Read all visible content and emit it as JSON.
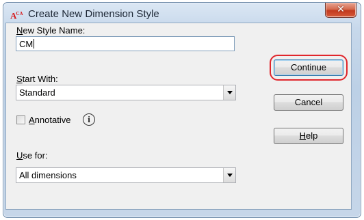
{
  "window": {
    "title": "Create New Dimension Style",
    "close_label": "✕"
  },
  "form": {
    "new_style_name_label": "New Style Name:",
    "new_style_name_value": "CM",
    "start_with_label": "Start With:",
    "start_with_value": "Standard",
    "annotative_label": "Annotative",
    "annotative_checked": false,
    "use_for_label": "Use for:",
    "use_for_value": "All dimensions"
  },
  "buttons": {
    "continue": "Continue",
    "cancel": "Cancel",
    "help": "Help"
  },
  "colors": {
    "highlight": "#e0262c",
    "app_icon": "#d7191c"
  }
}
